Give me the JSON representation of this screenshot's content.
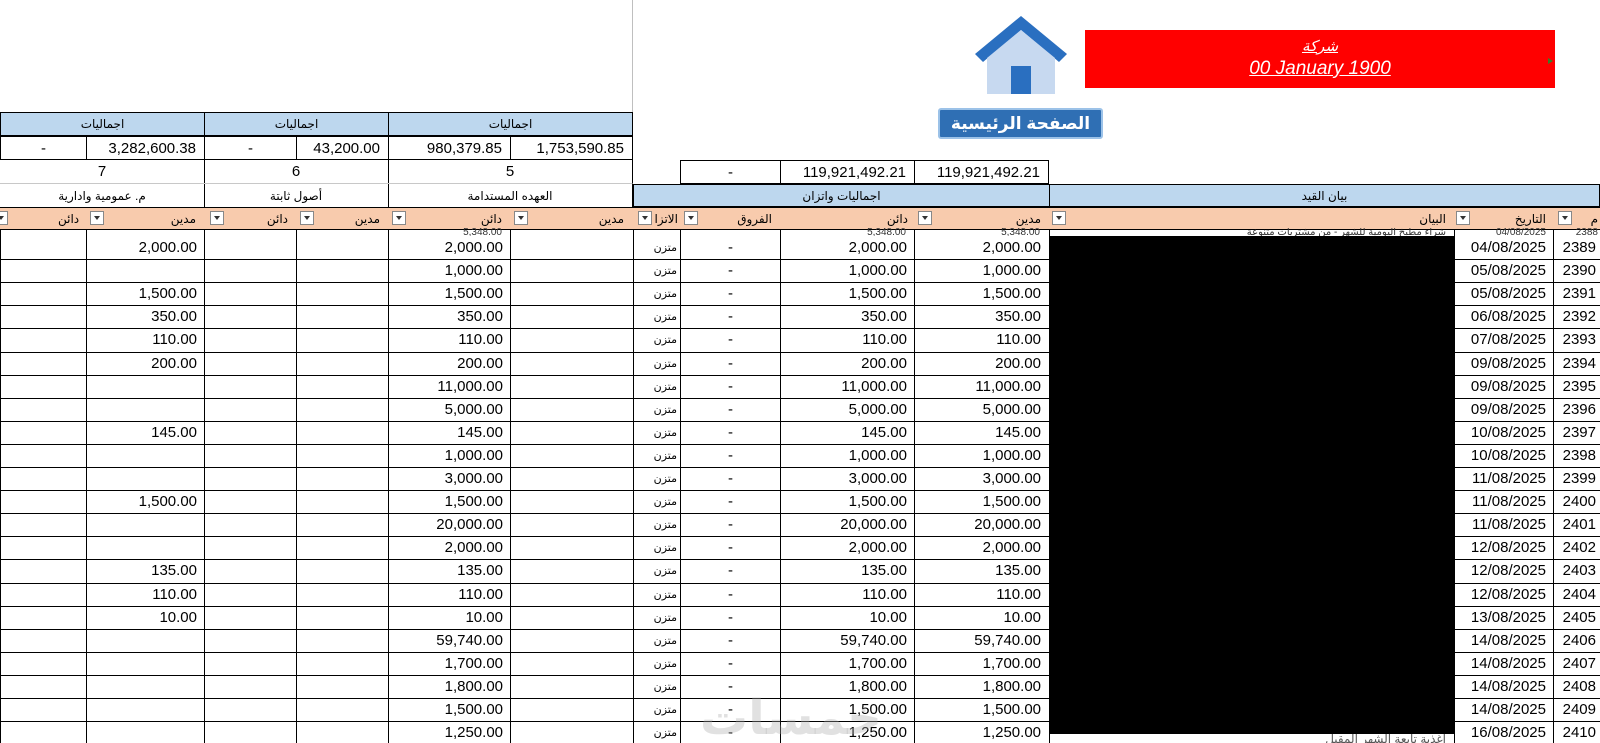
{
  "header": {
    "company": "شركة",
    "date": "00 January 1900",
    "home_button": "الصفحة الرئيسية"
  },
  "colors": {
    "banner": "#ff0000",
    "section_header": "#bdd7ee",
    "column_header": "#f8cbad",
    "home_button": "#2f6fb4",
    "house_roof": "#2a6fc0",
    "house_body": "#c7d9f0"
  },
  "totals_top": {
    "label1": "اجماليات",
    "label2": "اجماليات",
    "label3": "اجماليات",
    "v_dash1": "-",
    "v1": "3,282,600.38",
    "v_dash2": "-",
    "v2": "43,200.00",
    "v3a": "980,379.85",
    "v3b": "1,753,590.85",
    "n7": "7",
    "n6": "6",
    "n5": "5"
  },
  "balance_totals": {
    "diff": "-",
    "credit": "119,921,492.21",
    "debit": "119,921,492.21"
  },
  "section_headers": {
    "general_admin": "م. عمومية وادارية",
    "fixed_assets": "أصول ثابتة",
    "sustainable_custody": "العهده المستدامة",
    "balance_totals": "اجماليات واتزان",
    "entry_statement": "بيان القيد"
  },
  "column_headers": {
    "credit": "دائن",
    "debit": "مدين",
    "balance_status": "الاتزا",
    "differences": "الفروق",
    "description": "البيان",
    "date": "التاريخ",
    "number": "م"
  },
  "partial_first_row": {
    "value": "5,348.00",
    "text": "شراء مطبخ اليومية للشهر - من مشتريات متنوعة",
    "date": "04/08/2025",
    "number": "2388"
  },
  "rows": [
    {
      "ga_debit": "2,000.00",
      "custody_credit": "2,000.00",
      "status": "متزن",
      "diff": "-",
      "credit": "2,000.00",
      "debit": "2,000.00",
      "date": "04/08/2025",
      "num": "2389"
    },
    {
      "ga_debit": "",
      "custody_credit": "1,000.00",
      "status": "متزن",
      "diff": "-",
      "credit": "1,000.00",
      "debit": "1,000.00",
      "date": "05/08/2025",
      "num": "2390"
    },
    {
      "ga_debit": "1,500.00",
      "custody_credit": "1,500.00",
      "status": "متزن",
      "diff": "-",
      "credit": "1,500.00",
      "debit": "1,500.00",
      "date": "05/08/2025",
      "num": "2391"
    },
    {
      "ga_debit": "350.00",
      "custody_credit": "350.00",
      "status": "متزن",
      "diff": "-",
      "credit": "350.00",
      "debit": "350.00",
      "date": "06/08/2025",
      "num": "2392"
    },
    {
      "ga_debit": "110.00",
      "custody_credit": "110.00",
      "status": "متزن",
      "diff": "-",
      "credit": "110.00",
      "debit": "110.00",
      "date": "07/08/2025",
      "num": "2393"
    },
    {
      "ga_debit": "200.00",
      "custody_credit": "200.00",
      "status": "متزن",
      "diff": "-",
      "credit": "200.00",
      "debit": "200.00",
      "date": "09/08/2025",
      "num": "2394"
    },
    {
      "ga_debit": "",
      "custody_credit": "11,000.00",
      "status": "متزن",
      "diff": "-",
      "credit": "11,000.00",
      "debit": "11,000.00",
      "date": "09/08/2025",
      "num": "2395"
    },
    {
      "ga_debit": "",
      "custody_credit": "5,000.00",
      "status": "متزن",
      "diff": "-",
      "credit": "5,000.00",
      "debit": "5,000.00",
      "date": "09/08/2025",
      "num": "2396"
    },
    {
      "ga_debit": "145.00",
      "custody_credit": "145.00",
      "status": "متزن",
      "diff": "-",
      "credit": "145.00",
      "debit": "145.00",
      "date": "10/08/2025",
      "num": "2397"
    },
    {
      "ga_debit": "",
      "custody_credit": "1,000.00",
      "status": "متزن",
      "diff": "-",
      "credit": "1,000.00",
      "debit": "1,000.00",
      "date": "10/08/2025",
      "num": "2398"
    },
    {
      "ga_debit": "",
      "custody_credit": "3,000.00",
      "status": "متزن",
      "diff": "-",
      "credit": "3,000.00",
      "debit": "3,000.00",
      "date": "11/08/2025",
      "num": "2399"
    },
    {
      "ga_debit": "1,500.00",
      "custody_credit": "1,500.00",
      "status": "متزن",
      "diff": "-",
      "credit": "1,500.00",
      "debit": "1,500.00",
      "date": "11/08/2025",
      "num": "2400"
    },
    {
      "ga_debit": "",
      "custody_credit": "20,000.00",
      "status": "متزن",
      "diff": "-",
      "credit": "20,000.00",
      "debit": "20,000.00",
      "date": "11/08/2025",
      "num": "2401"
    },
    {
      "ga_debit": "",
      "custody_credit": "2,000.00",
      "status": "متزن",
      "diff": "-",
      "credit": "2,000.00",
      "debit": "2,000.00",
      "date": "12/08/2025",
      "num": "2402"
    },
    {
      "ga_debit": "135.00",
      "custody_credit": "135.00",
      "status": "متزن",
      "diff": "-",
      "credit": "135.00",
      "debit": "135.00",
      "date": "12/08/2025",
      "num": "2403"
    },
    {
      "ga_debit": "110.00",
      "custody_credit": "110.00",
      "status": "متزن",
      "diff": "-",
      "credit": "110.00",
      "debit": "110.00",
      "date": "12/08/2025",
      "num": "2404"
    },
    {
      "ga_debit": "10.00",
      "custody_credit": "10.00",
      "status": "متزن",
      "diff": "-",
      "credit": "10.00",
      "debit": "10.00",
      "date": "13/08/2025",
      "num": "2405"
    },
    {
      "ga_debit": "",
      "custody_credit": "59,740.00",
      "status": "متزن",
      "diff": "-",
      "credit": "59,740.00",
      "debit": "59,740.00",
      "date": "14/08/2025",
      "num": "2406"
    },
    {
      "ga_debit": "",
      "custody_credit": "1,700.00",
      "status": "متزن",
      "diff": "-",
      "credit": "1,700.00",
      "debit": "1,700.00",
      "date": "14/08/2025",
      "num": "2407"
    },
    {
      "ga_debit": "",
      "custody_credit": "1,800.00",
      "status": "متزن",
      "diff": "-",
      "credit": "1,800.00",
      "debit": "1,800.00",
      "date": "14/08/2025",
      "num": "2408"
    },
    {
      "ga_debit": "",
      "custody_credit": "1,500.00",
      "status": "متزن",
      "diff": "-",
      "credit": "1,500.00",
      "debit": "1,500.00",
      "date": "14/08/2025",
      "num": "2409"
    },
    {
      "ga_debit": "",
      "custody_credit": "1,250.00",
      "status": "متزن",
      "diff": "-",
      "credit": "1,250.00",
      "debit": "1,250.00",
      "date": "16/08/2025",
      "num": "2410"
    }
  ],
  "last_row_text": "اغذية تابعة الشهر المقبل",
  "watermark": "خمسات"
}
